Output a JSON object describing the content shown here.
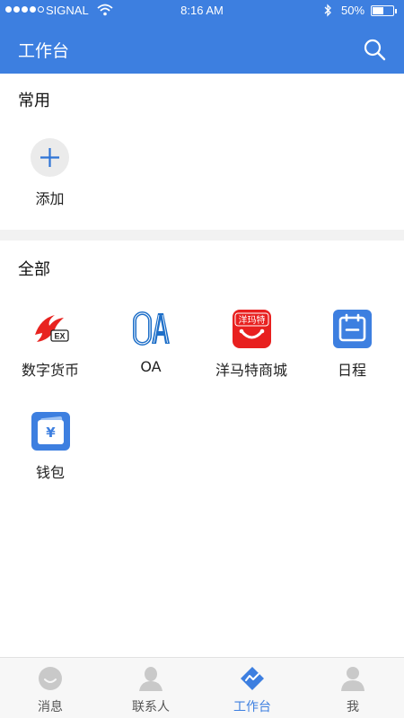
{
  "status_bar": {
    "carrier": "SIGNAL",
    "time": "8:16 AM",
    "battery": "50%",
    "signal_strength": 4,
    "battery_level": 0.5
  },
  "header": {
    "title": "工作台",
    "icon": "search-icon",
    "bg_color": "#3d7fe0"
  },
  "common": {
    "title": "常用",
    "add_label": "添加",
    "add_icon": "plus-icon"
  },
  "all": {
    "title": "全部",
    "apps": [
      {
        "label": "数字货币",
        "icon": "digital-currency-logo-icon"
      },
      {
        "label": "OA",
        "icon": "oa-logo-icon"
      },
      {
        "label": "洋马特商城",
        "icon": "yangmate-mall-icon",
        "icon_text": "洋玛特"
      },
      {
        "label": "日程",
        "icon": "calendar-icon"
      },
      {
        "label": "钱包",
        "icon": "wallet-icon",
        "icon_text": "¥"
      }
    ]
  },
  "tabbar": {
    "tabs": [
      {
        "label": "消息",
        "icon": "message-face-icon",
        "active": false
      },
      {
        "label": "联系人",
        "icon": "contacts-person-icon",
        "active": false
      },
      {
        "label": "工作台",
        "icon": "workbench-icon",
        "active": true
      },
      {
        "label": "我",
        "icon": "me-person-icon",
        "active": false
      }
    ],
    "active_color": "#3d7fe0"
  }
}
